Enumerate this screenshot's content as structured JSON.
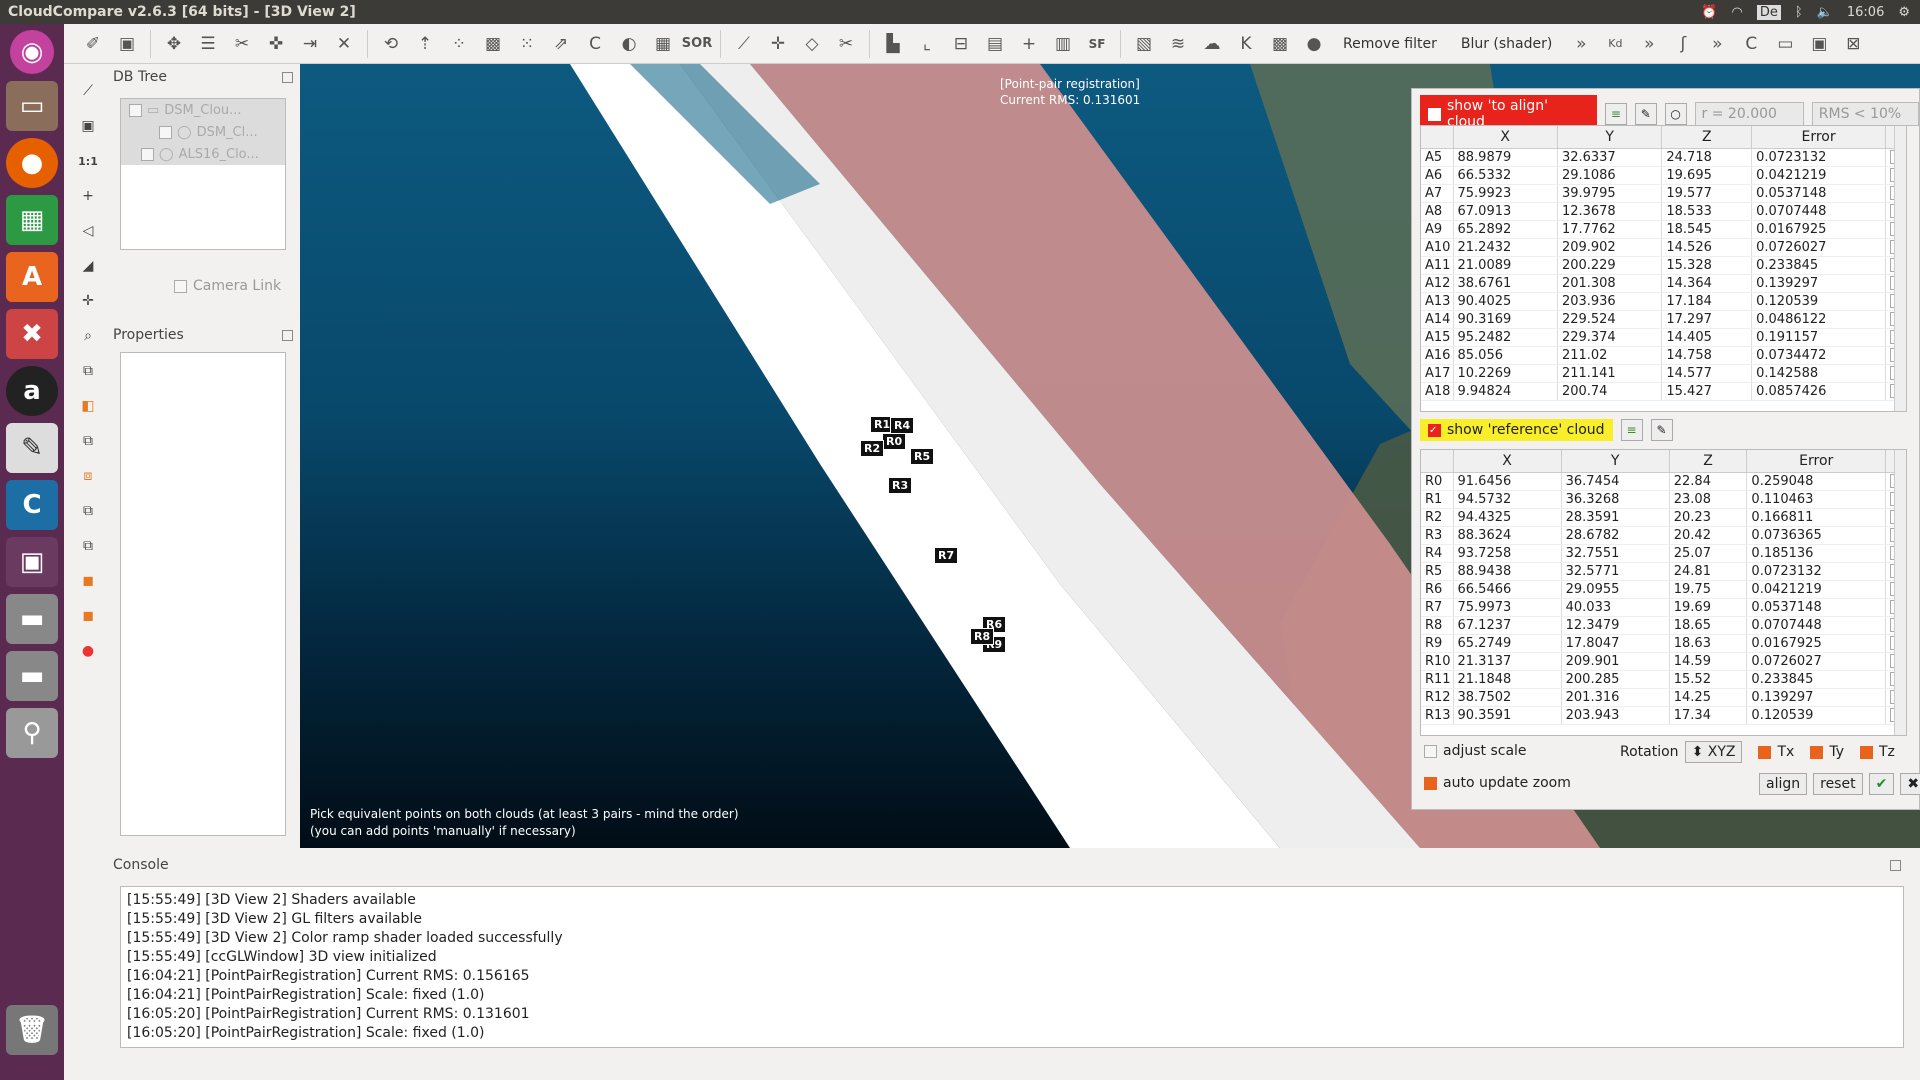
{
  "window_title": "CloudCompare v2.6.3 [64 bits] - [3D View 2]",
  "tray": {
    "clock": "16:06",
    "lang": "De"
  },
  "toolbar": {
    "remove_filter": "Remove filter",
    "blur": "Blur (shader)"
  },
  "db_tree": {
    "title": "DB Tree",
    "items": [
      "DSM_Clou...",
      "DSM_Cl...",
      "ALS16_Clo..."
    ]
  },
  "camera_link": "Camera Link",
  "properties": {
    "title": "Properties"
  },
  "view": {
    "rms_title": "[Point-pair registration]",
    "rms_value": "Current RMS: 0.131601",
    "hint1": "Pick equivalent points on both clouds (at least 3 pairs - mind the order)",
    "hint2": "(you can add points 'manually' if necessary)",
    "labels": [
      "R1",
      "R4",
      "R0",
      "R2",
      "R5",
      "R3",
      "R7",
      "R6",
      "R9",
      "R8"
    ]
  },
  "align_panel": {
    "show_align": "show 'to align' cloud",
    "radius": "r = 20.000",
    "rms_filter": "RMS < 10%",
    "columns": [
      "",
      "X",
      "Y",
      "Z",
      "Error"
    ],
    "align_rows": [
      [
        "A5",
        "88.9879",
        "32.6337",
        "24.718",
        "0.0723132"
      ],
      [
        "A6",
        "66.5332",
        "29.1086",
        "19.695",
        "0.0421219"
      ],
      [
        "A7",
        "75.9923",
        "39.9795",
        "19.577",
        "0.0537148"
      ],
      [
        "A8",
        "67.0913",
        "12.3678",
        "18.533",
        "0.0707448"
      ],
      [
        "A9",
        "65.2892",
        "17.7762",
        "18.545",
        "0.0167925"
      ],
      [
        "A10",
        "21.2432",
        "209.902",
        "14.526",
        "0.0726027"
      ],
      [
        "A11",
        "21.0089",
        "200.229",
        "15.328",
        "0.233845"
      ],
      [
        "A12",
        "38.6761",
        "201.308",
        "14.364",
        "0.139297"
      ],
      [
        "A13",
        "90.4025",
        "203.936",
        "17.184",
        "0.120539"
      ],
      [
        "A14",
        "90.3169",
        "229.524",
        "17.297",
        "0.0486122"
      ],
      [
        "A15",
        "95.2482",
        "229.374",
        "14.405",
        "0.191157"
      ],
      [
        "A16",
        "85.056",
        "211.02",
        "14.758",
        "0.0734472"
      ],
      [
        "A17",
        "10.2269",
        "211.141",
        "14.577",
        "0.142588"
      ],
      [
        "A18",
        "9.94824",
        "200.74",
        "15.427",
        "0.0857426"
      ]
    ],
    "show_ref": "show 'reference' cloud",
    "ref_rows": [
      [
        "R0",
        "91.6456",
        "36.7454",
        "22.84",
        "0.259048"
      ],
      [
        "R1",
        "94.5732",
        "36.3268",
        "23.08",
        "0.110463"
      ],
      [
        "R2",
        "94.4325",
        "28.3591",
        "20.23",
        "0.166811"
      ],
      [
        "R3",
        "88.3624",
        "28.6782",
        "20.42",
        "0.0736365"
      ],
      [
        "R4",
        "93.7258",
        "32.7551",
        "25.07",
        "0.185136"
      ],
      [
        "R5",
        "88.9438",
        "32.5771",
        "24.81",
        "0.0723132"
      ],
      [
        "R6",
        "66.5466",
        "29.0955",
        "19.75",
        "0.0421219"
      ],
      [
        "R7",
        "75.9973",
        "40.033",
        "19.69",
        "0.0537148"
      ],
      [
        "R8",
        "67.1237",
        "12.3479",
        "18.65",
        "0.0707448"
      ],
      [
        "R9",
        "65.2749",
        "17.8047",
        "18.63",
        "0.0167925"
      ],
      [
        "R10",
        "21.3137",
        "209.901",
        "14.59",
        "0.0726027"
      ],
      [
        "R11",
        "21.1848",
        "200.285",
        "15.52",
        "0.233845"
      ],
      [
        "R12",
        "38.7502",
        "201.316",
        "14.25",
        "0.139297"
      ],
      [
        "R13",
        "90.3591",
        "203.943",
        "17.34",
        "0.120539"
      ]
    ],
    "adjust_scale": "adjust scale",
    "rotation_label": "Rotation",
    "rotation_value": "XYZ",
    "tx": "Tx",
    "ty": "Ty",
    "tz": "Tz",
    "auto_zoom": "auto update zoom",
    "align_btn": "align",
    "reset_btn": "reset"
  },
  "console": {
    "title": "Console",
    "lines": [
      "[15:55:49] [3D View 2] Shaders available",
      "[15:55:49] [3D View 2] GL filters available",
      "[15:55:49] [3D View 2] Color ramp shader loaded successfully",
      "[15:55:49] [ccGLWindow] 3D view initialized",
      "[16:04:21] [PointPairRegistration] Current RMS: 0.156165",
      "[16:04:21] [PointPairRegistration] Scale: fixed (1.0)",
      "[16:05:20] [PointPairRegistration] Current RMS: 0.131601",
      "[16:05:20] [PointPairRegistration] Scale: fixed (1.0)"
    ]
  }
}
